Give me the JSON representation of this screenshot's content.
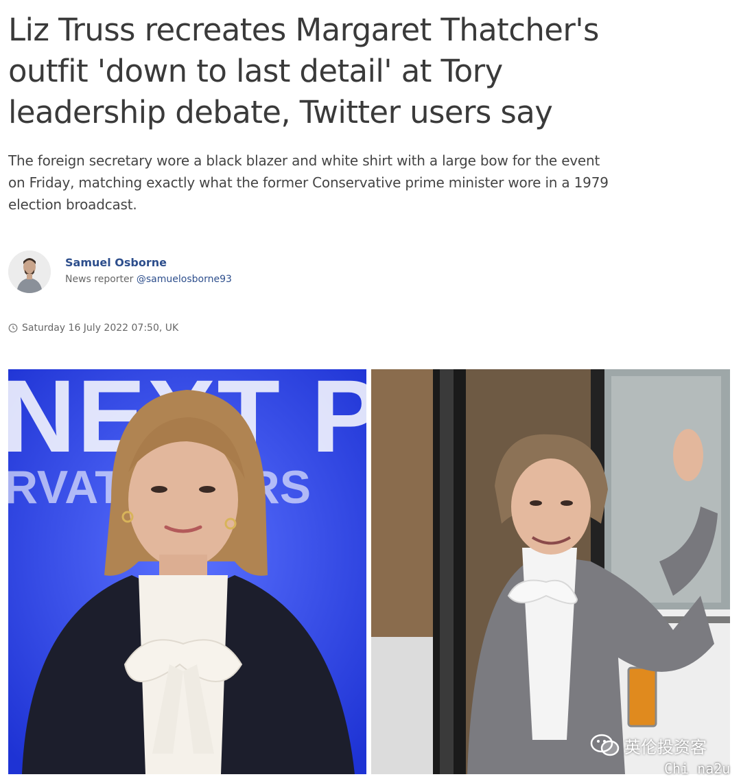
{
  "article": {
    "headline": "Liz Truss recreates Margaret Thatcher's outfit 'down to last detail' at Tory leadership debate, Twitter users say",
    "standfirst": "The foreign secretary wore a black blazer and white shirt with a large bow for the event on Friday, matching exactly what the former Conservative prime minister wore in a 1979 election broadcast.",
    "author": {
      "name": "Samuel Osborne",
      "role": "News reporter",
      "handle": "@samuelosborne93"
    },
    "timestamp": "Saturday 16 July 2022 07:50, UK",
    "timestamp_icon": "clock-icon"
  },
  "images": {
    "left": {
      "backdrop_text_top": "NEXT PI",
      "backdrop_text_bottom": "RVATI ADERS"
    }
  },
  "watermark": {
    "icon": "wechat-icon",
    "label": "英伦投资客",
    "site": "Chi na2u"
  },
  "colors": {
    "headline": "#3a3a3a",
    "link": "#2d4e8c",
    "muted": "#666666",
    "stage_blue": "#2b46e0"
  }
}
